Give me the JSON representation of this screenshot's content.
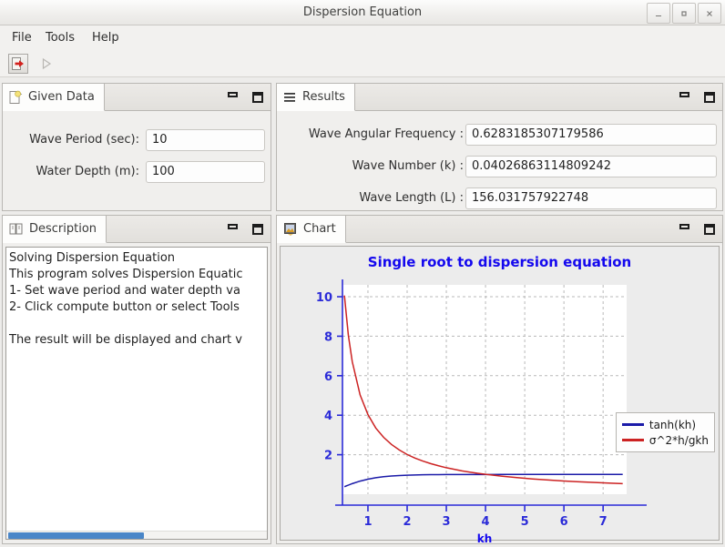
{
  "window": {
    "title": "Dispersion Equation",
    "minimize_label": "_",
    "maximize_label": "▫",
    "close_label": "×"
  },
  "menubar": {
    "items": [
      {
        "label": "File"
      },
      {
        "label": "Tools"
      },
      {
        "label": "Help"
      }
    ]
  },
  "toolbar": {
    "exit_icon": "exit-icon",
    "run_icon": "run-icon"
  },
  "given_data": {
    "tab_label": "Given Data",
    "tab_icon": "document-star-icon",
    "fields": [
      {
        "label": "Wave Period (sec):",
        "value": "10"
      },
      {
        "label": "Water Depth (m):",
        "value": "100"
      }
    ]
  },
  "results": {
    "tab_label": "Results",
    "tab_icon": "list-lines-icon",
    "fields": [
      {
        "label": "Wave Angular Frequency :",
        "value": "0.6283185307179586"
      },
      {
        "label": "Wave Number (k) :",
        "value": "0.04026863114809242"
      },
      {
        "label": "Wave Length (L) :",
        "value": "156.031757922748"
      }
    ]
  },
  "description": {
    "tab_label": "Description",
    "tab_icon": "book-icon",
    "text": "Solving Dispersion Equation\nThis program solves Dispersion Equatic\n1- Set wave period and water depth va\n2- Click compute button or select Tools\n\nThe result will be displayed and chart v",
    "scroll_percent": 52
  },
  "chart_panel": {
    "tab_label": "Chart",
    "tab_icon": "image-icon"
  },
  "chart_data": {
    "type": "line",
    "title": "Single root to dispersion equation",
    "xlabel": "kh",
    "ylabel": "",
    "xlim": [
      0.35,
      7.6
    ],
    "ylim": [
      0,
      10.6
    ],
    "xticks": [
      1,
      2,
      3,
      4,
      5,
      6,
      7
    ],
    "yticks": [
      2,
      4,
      6,
      8,
      10
    ],
    "grid": true,
    "legend_position": "right-outside",
    "title_color": "#1408ee",
    "axis_color": "#2b2bd8",
    "series": [
      {
        "name": "tanh(kh)",
        "color": "#1a1aa8",
        "x": [
          0.4,
          0.6,
          0.8,
          1.0,
          1.2,
          1.4,
          1.6,
          1.8,
          2.0,
          2.2,
          2.4,
          2.6,
          2.8,
          3.0,
          3.2,
          3.4,
          3.6,
          3.8,
          4.0,
          4.03,
          4.4,
          4.8,
          5.2,
          5.6,
          6.0,
          6.4,
          6.8,
          7.2,
          7.5
        ],
        "y": [
          0.38,
          0.537,
          0.664,
          0.762,
          0.834,
          0.885,
          0.922,
          0.947,
          0.964,
          0.976,
          0.984,
          0.989,
          0.993,
          0.995,
          0.997,
          0.998,
          0.998,
          0.999,
          0.999,
          0.999,
          1.0,
          1.0,
          1.0,
          1.0,
          1.0,
          1.0,
          1.0,
          1.0,
          1.0
        ]
      },
      {
        "name": "σ^2*h/gkh",
        "color": "#cc2222",
        "x": [
          0.4,
          0.5,
          0.6,
          0.8,
          1.0,
          1.2,
          1.4,
          1.6,
          1.8,
          2.0,
          2.2,
          2.4,
          2.6,
          2.8,
          3.0,
          3.2,
          3.4,
          3.6,
          3.8,
          4.0,
          4.03,
          4.4,
          4.8,
          5.2,
          5.6,
          6.0,
          6.4,
          6.8,
          7.2,
          7.5
        ],
        "y": [
          10.06,
          8.05,
          6.71,
          5.03,
          4.03,
          3.35,
          2.88,
          2.52,
          2.24,
          2.01,
          1.83,
          1.68,
          1.55,
          1.44,
          1.34,
          1.26,
          1.18,
          1.12,
          1.06,
          1.01,
          1.0,
          0.915,
          0.839,
          0.774,
          0.719,
          0.671,
          0.629,
          0.592,
          0.559,
          0.537
        ]
      }
    ]
  }
}
